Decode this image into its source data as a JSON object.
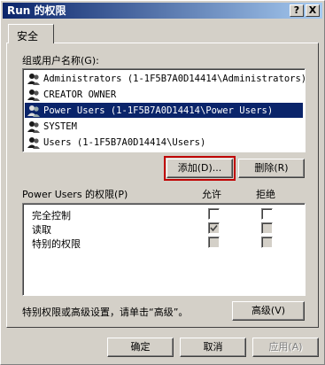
{
  "window": {
    "title": "Run 的权限",
    "help_label": "?",
    "close_label": "X"
  },
  "tab": {
    "label": "安全"
  },
  "groups": {
    "label": "组或用户名称(G):",
    "items": [
      {
        "name": "Administrators (1-1F5B7A0D14414\\Administrators)",
        "selected": false
      },
      {
        "name": "CREATOR OWNER",
        "selected": false
      },
      {
        "name": "Power Users (1-1F5B7A0D14414\\Power Users)",
        "selected": true
      },
      {
        "name": "SYSTEM",
        "selected": false
      },
      {
        "name": "Users (1-1F5B7A0D14414\\Users)",
        "selected": false
      }
    ],
    "add_label": "添加(D)...",
    "remove_label": "删除(R)"
  },
  "permissions": {
    "label": "Power Users 的权限(P)",
    "allow_header": "允许",
    "deny_header": "拒绝",
    "rows": [
      {
        "name": "完全控制",
        "allow": "unchecked",
        "deny": "unchecked"
      },
      {
        "name": "读取",
        "allow": "checked-gray",
        "deny": "unchecked-gray"
      },
      {
        "name": "特别的权限",
        "allow": "unchecked-gray",
        "deny": "unchecked-gray"
      }
    ]
  },
  "advanced": {
    "hint": "特别权限或高级设置，请单击“高级”。",
    "button_label": "高级(V)"
  },
  "footer": {
    "ok_label": "确定",
    "cancel_label": "取消",
    "apply_label": "应用(A)"
  },
  "colors": {
    "face": "#d4d0c8",
    "selection": "#0a246a",
    "focus_outline": "#c00000"
  },
  "icons": {
    "user": "user-group-icon",
    "check": "check-mark-icon"
  }
}
